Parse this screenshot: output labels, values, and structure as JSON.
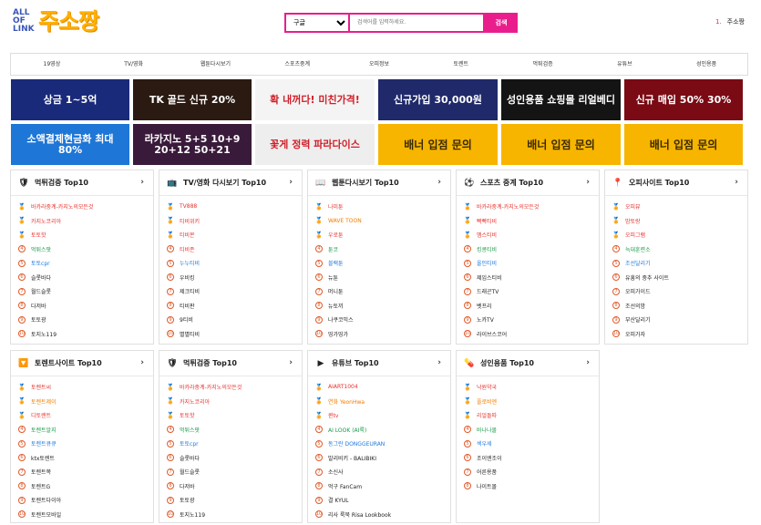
{
  "logo": {
    "small": "ALL OF LINK",
    "big": "주소짱"
  },
  "search": {
    "select": "구글",
    "placeholder": "검색어를 입력하세요.",
    "button": "검색"
  },
  "header_right": {
    "num": "1.",
    "label": "주소짱"
  },
  "nav": [
    "19영상",
    "TV/영화",
    "웹툰다시보기",
    "스포츠중계",
    "오피정보",
    "토렌트",
    "먹튀검증",
    "유튜브",
    "성인용품"
  ],
  "banner_row1": [
    {
      "text": "상금 1~5억",
      "bg": "#1a2a7a"
    },
    {
      "text": "TK 골드 신규 20%",
      "bg": "#2a1a12"
    },
    {
      "text": "확 내꺼다! 미친가격!",
      "bg": "#f4f4f4"
    },
    {
      "text": "신규가입 30,000원",
      "bg": "#202a6a"
    },
    {
      "text": "성인용품 쇼핑몰 리얼베디",
      "bg": "#141414"
    },
    {
      "text": "신규 매입 50% 30%",
      "bg": "#7a0a14"
    }
  ],
  "banner_row2": [
    {
      "text": "소액결제현금화 최대 80%",
      "bg": "#1e76d6"
    },
    {
      "text": "라카지노 5+5 10+9 20+12 50+21",
      "bg": "#3a1a3a"
    },
    {
      "text": "꽃게 정력 파라다이스",
      "bg": "#eee"
    },
    {
      "text": "배너 입점 문의",
      "bg": "#f7b500"
    },
    {
      "text": "배너 입점 문의",
      "bg": "#f7b500"
    },
    {
      "text": "배너 입점 문의",
      "bg": "#f7b500"
    }
  ],
  "cards": [
    {
      "title": "먹튀검증 Top10",
      "icon": "shield-icon",
      "items": [
        {
          "t": "바카라중계-카지노의모든것",
          "c": "red"
        },
        {
          "t": "카지노코리아",
          "c": "red"
        },
        {
          "t": "토토핫",
          "c": "red"
        },
        {
          "t": "먹튀스팟",
          "c": "green"
        },
        {
          "t": "토토cpr",
          "c": "blue"
        },
        {
          "t": "슬롯바다",
          "c": "dark"
        },
        {
          "t": "월드슬롯",
          "c": "dark"
        },
        {
          "t": "다저바",
          "c": "dark"
        },
        {
          "t": "토토광",
          "c": "dark"
        },
        {
          "t": "토지노119",
          "c": "dark"
        }
      ]
    },
    {
      "title": "TV/영화 다시보기 Top10",
      "icon": "tv-icon",
      "items": [
        {
          "t": "TV888",
          "c": "red"
        },
        {
          "t": "티비위키",
          "c": "red"
        },
        {
          "t": "티비몬",
          "c": "red"
        },
        {
          "t": "티비존",
          "c": "red"
        },
        {
          "t": "누누티비",
          "c": "blue"
        },
        {
          "t": "우비킹",
          "c": "dark"
        },
        {
          "t": "제크티비",
          "c": "dark"
        },
        {
          "t": "티비판",
          "c": "dark"
        },
        {
          "t": "9티비",
          "c": "dark"
        },
        {
          "t": "별별티비",
          "c": "dark"
        }
      ]
    },
    {
      "title": "웹툰다시보기 Top10",
      "icon": "book-icon",
      "items": [
        {
          "t": "나미툰",
          "c": "red"
        },
        {
          "t": "WAVE TOON",
          "c": "orange"
        },
        {
          "t": "우로툰",
          "c": "red"
        },
        {
          "t": "툰코",
          "c": "green"
        },
        {
          "t": "블랙툰",
          "c": "blue"
        },
        {
          "t": "뉴툰",
          "c": "dark"
        },
        {
          "t": "머니툰",
          "c": "dark"
        },
        {
          "t": "뉴토끼",
          "c": "dark"
        },
        {
          "t": "나쿠코믹스",
          "c": "dark"
        },
        {
          "t": "띵가띵가",
          "c": "dark"
        }
      ]
    },
    {
      "title": "스포츠 중계 Top10",
      "icon": "sports-icon",
      "items": [
        {
          "t": "바카라중계-카지노의모든것",
          "c": "red"
        },
        {
          "t": "빡빡티비",
          "c": "red"
        },
        {
          "t": "맴스티비",
          "c": "red"
        },
        {
          "t": "킹콩티비",
          "c": "green"
        },
        {
          "t": "올인티비",
          "c": "blue"
        },
        {
          "t": "제임스티비",
          "c": "dark"
        },
        {
          "t": "드래곤TV",
          "c": "dark"
        },
        {
          "t": "벳프리",
          "c": "dark"
        },
        {
          "t": "노카TV",
          "c": "dark"
        },
        {
          "t": "라이브스코어",
          "c": "dark"
        }
      ]
    },
    {
      "title": "오피사이트 Top10",
      "icon": "location-pin-icon",
      "items": [
        {
          "t": "오피뷰",
          "c": "red"
        },
        {
          "t": "밤토랑",
          "c": "red"
        },
        {
          "t": "오피그램",
          "c": "red"
        },
        {
          "t": "늑대훈련소",
          "c": "green"
        },
        {
          "t": "조선달리기",
          "c": "blue"
        },
        {
          "t": "유흥의 중추 사이트",
          "c": "dark"
        },
        {
          "t": "오피가이드",
          "c": "dark"
        },
        {
          "t": "조선의밤",
          "c": "dark"
        },
        {
          "t": "부산달리기",
          "c": "dark"
        },
        {
          "t": "오피가자",
          "c": "dark"
        }
      ]
    },
    {
      "title": "토렌트사이트 Top10",
      "icon": "torrent-icon",
      "items": [
        {
          "t": "토렌트씨",
          "c": "red"
        },
        {
          "t": "토렌트제이",
          "c": "orange"
        },
        {
          "t": "디토렌트",
          "c": "red"
        },
        {
          "t": "토렌트알지",
          "c": "green"
        },
        {
          "t": "토렌트큐큐",
          "c": "blue"
        },
        {
          "t": "ktx토렌트",
          "c": "dark"
        },
        {
          "t": "토렌트쪽",
          "c": "dark"
        },
        {
          "t": "토렌트G",
          "c": "dark"
        },
        {
          "t": "토렌트다이아",
          "c": "dark"
        },
        {
          "t": "토렌트모바일",
          "c": "dark"
        }
      ]
    },
    {
      "title": "먹튀검증 Top10",
      "icon": "shield-icon",
      "items": [
        {
          "t": "바카라중계-카지노의모든것",
          "c": "red"
        },
        {
          "t": "카지노코리아",
          "c": "red"
        },
        {
          "t": "토토핫",
          "c": "red"
        },
        {
          "t": "먹튀스팟",
          "c": "green"
        },
        {
          "t": "토토cpr",
          "c": "blue"
        },
        {
          "t": "슬롯바다",
          "c": "dark"
        },
        {
          "t": "월드슬롯",
          "c": "dark"
        },
        {
          "t": "다저바",
          "c": "dark"
        },
        {
          "t": "토토광",
          "c": "dark"
        },
        {
          "t": "토지노119",
          "c": "dark"
        }
      ]
    },
    {
      "title": "유튜브 Top10",
      "icon": "youtube-icon",
      "items": [
        {
          "t": "AIART1004",
          "c": "red"
        },
        {
          "t": "연화 YeonHwa",
          "c": "orange"
        },
        {
          "t": "퀸tv",
          "c": "red"
        },
        {
          "t": "AI LOOK (AI룩)",
          "c": "green"
        },
        {
          "t": "동그란 DONGGEURAN",
          "c": "blue"
        },
        {
          "t": "발리비키 - BALIBIKI",
          "c": "dark"
        },
        {
          "t": "소신사",
          "c": "dark"
        },
        {
          "t": "먹구 FanCam",
          "c": "dark"
        },
        {
          "t": "결 KYUL",
          "c": "dark"
        },
        {
          "t": "리사 룩북 Risa Lookbook",
          "c": "dark"
        }
      ]
    },
    {
      "title": "성인용품 Top10",
      "icon": "adult-goods-icon",
      "items": [
        {
          "t": "낙원약국",
          "c": "red"
        },
        {
          "t": "플로비엔",
          "c": "orange"
        },
        {
          "t": "리얼돌따",
          "c": "red"
        },
        {
          "t": "바나나몰",
          "c": "green"
        },
        {
          "t": "섹우세",
          "c": "blue"
        },
        {
          "t": "조이엔조이",
          "c": "dark"
        },
        {
          "t": "어른용품",
          "c": "dark"
        },
        {
          "t": "나이트몰",
          "c": "dark"
        }
      ]
    }
  ]
}
